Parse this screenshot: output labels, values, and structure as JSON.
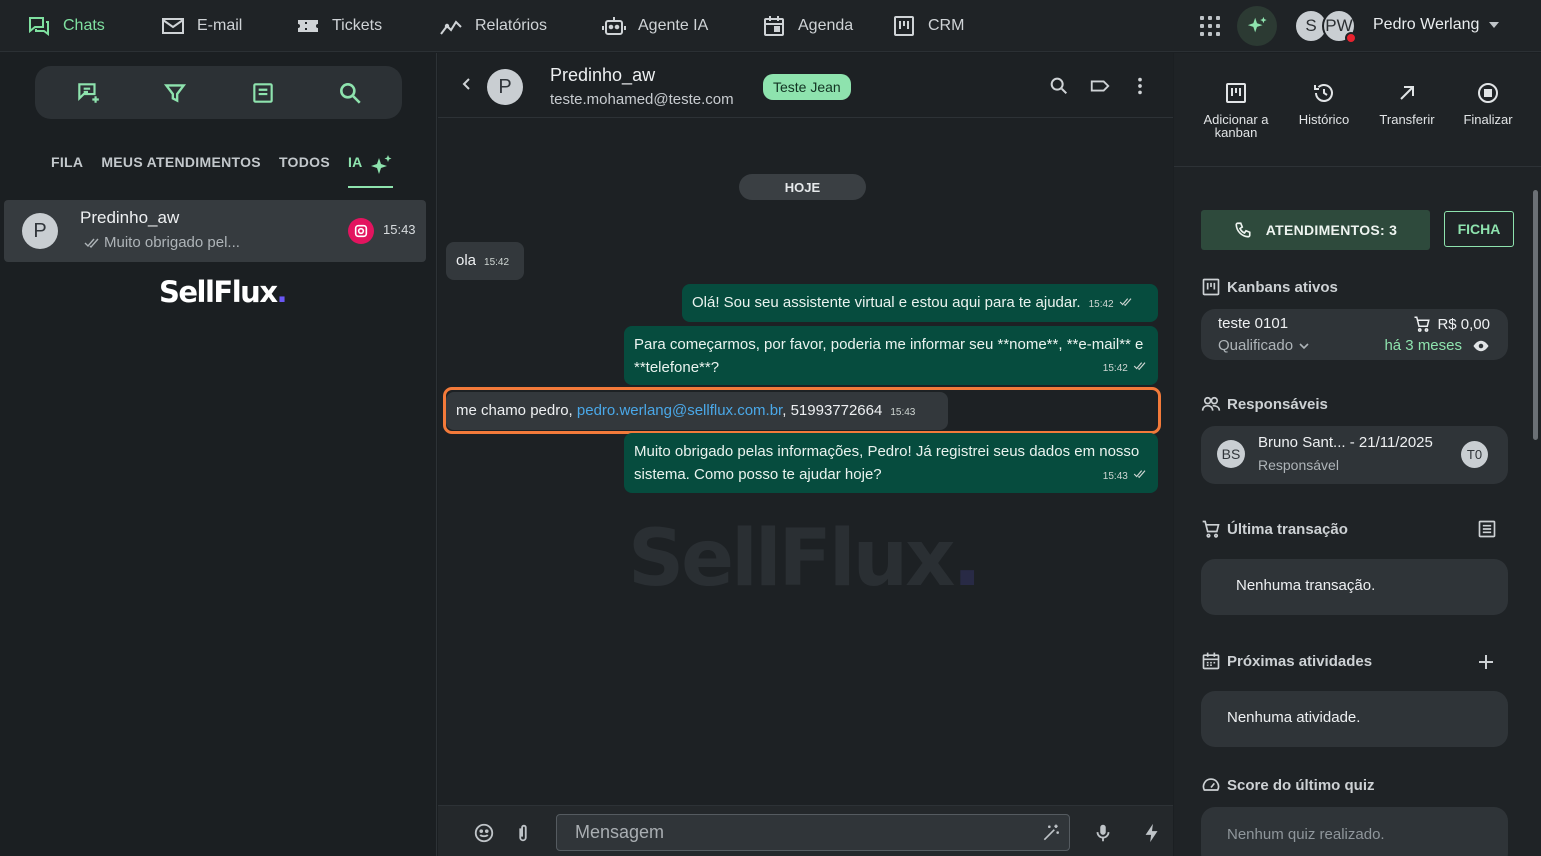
{
  "nav": {
    "items": [
      {
        "label": "Chats",
        "icon": "chat-bubbles-icon"
      },
      {
        "label": "E-mail",
        "icon": "mail-icon"
      },
      {
        "label": "Tickets",
        "icon": "ticket-icon"
      },
      {
        "label": "Relatórios",
        "icon": "chart-line-icon"
      },
      {
        "label": "Agente IA",
        "icon": "robot-icon"
      },
      {
        "label": "Agenda",
        "icon": "calendar-icon"
      },
      {
        "label": "CRM",
        "icon": "kanban-icon"
      }
    ],
    "user_name": "Pedro Werlang",
    "avatar_initials_1": "S",
    "avatar_initials_2": "PW"
  },
  "sidebar": {
    "tabs": [
      "FILA",
      "MEUS ATENDIMENTOS",
      "TODOS",
      "IA"
    ],
    "active_tab": "IA",
    "chats": [
      {
        "initial": "P",
        "name": "Predinho_aw",
        "preview": "Muito obrigado pel...",
        "time": "15:43",
        "channel": "instagram"
      }
    ],
    "brand_text": "SellFlux",
    "brand_dot": "."
  },
  "chat": {
    "contact_initial": "P",
    "contact_name": "Predinho_aw",
    "contact_email": "teste.mohamed@teste.com",
    "tag": "Teste Jean",
    "date_label": "HOJE",
    "watermark": "SellFlux",
    "messages": [
      {
        "dir": "in",
        "text": "ola",
        "time": "15:42"
      },
      {
        "dir": "out",
        "text": "Olá! Sou seu assistente virtual e estou aqui para te ajudar.",
        "time": "15:42"
      },
      {
        "dir": "out",
        "text": "Para começarmos, por favor, poderia me informar seu **nome**, **e-mail** e **telefone**?",
        "time": "15:42"
      },
      {
        "dir": "in",
        "text_before": "me chamo pedro, ",
        "link": "pedro.werlang@sellflux.com.br",
        "text_after": ", 51993772664",
        "time": "15:43"
      },
      {
        "dir": "out",
        "text": "Muito obrigado pelas informações, Pedro! Já registrei seus dados em nosso sistema. Como posso te ajudar hoje?",
        "time": "15:43"
      }
    ],
    "composer_placeholder": "Mensagem"
  },
  "panel": {
    "actions": [
      {
        "label": "Adicionar a kanban",
        "icon": "kanban-add-icon"
      },
      {
        "label": "Histórico",
        "icon": "history-icon"
      },
      {
        "label": "Transferir",
        "icon": "arrow-up-right-icon"
      },
      {
        "label": "Finalizar",
        "icon": "stop-circle-icon"
      }
    ],
    "atendimentos_label": "ATENDIMENTOS: 3",
    "ficha_label": "FICHA",
    "kanbans_title": "Kanbans ativos",
    "kanban": {
      "name": "teste 0101",
      "status": "Qualificado",
      "value": "R$ 0,00",
      "age": "há 3 meses"
    },
    "responsaveis_title": "Responsáveis",
    "responsavel": {
      "initials": "BS",
      "name": "Bruno Sant... - 21/11/2025",
      "role": "Responsável",
      "badge": "T0"
    },
    "transacao_title": "Última transação",
    "transacao_empty": "Nenhuma transação.",
    "atividades_title": "Próximas atividades",
    "atividades_empty": "Nenhuma atividade.",
    "quiz_title": "Score do último quiz",
    "quiz_empty": "Nenhum quiz realizado."
  },
  "colors": {
    "accent": "#8ee3ae",
    "outgoing_bubble": "#064c3e",
    "incoming_bubble": "#33383c",
    "highlight": "#f37a3a",
    "instagram": "#e3145f"
  }
}
